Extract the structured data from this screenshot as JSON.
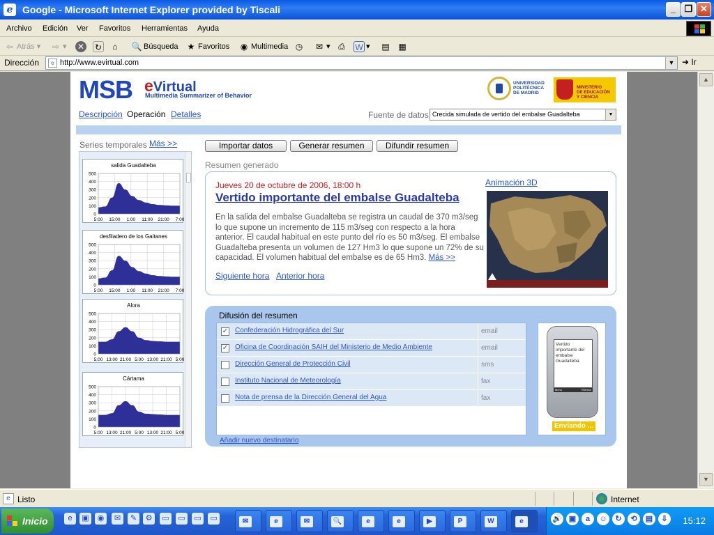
{
  "window": {
    "title": "Google - Microsoft Internet Explorer provided by Tiscali"
  },
  "menu": [
    "Archivo",
    "Edición",
    "Ver",
    "Favoritos",
    "Herramientas",
    "Ayuda"
  ],
  "toolbar": {
    "back": "Atrás",
    "search": "Búsqueda",
    "favorites": "Favoritos",
    "multimedia": "Multimedia"
  },
  "address": {
    "label": "Dirección",
    "url": "http://www.evirtual.com",
    "go": "Ir"
  },
  "page": {
    "logo": {
      "msb": "MSB",
      "ev_e": "e",
      "ev_rest": "Virtual",
      "subtitle": "Multimedia Summarizer of Behavior"
    },
    "upm_text": "UNIVERSIDAD\nPOLITÉCNICA\nDE MADRID",
    "mec_text": "MINISTERIO\nDE EDUCACIÓN\nY CIENCIA",
    "nav": {
      "descripcion": "Descripción",
      "operacion": "Operación",
      "detalles": "Detalles"
    },
    "fuente": {
      "label": "Fuente de datos:",
      "value": "Crecida simulada de vertido del embalse Guadalteba"
    },
    "series": {
      "title": "Series temporales",
      "more": "Más >>"
    },
    "buttons": {
      "importar": "Importar datos",
      "generar": "Generar resumen",
      "difundir": "Difundir resumen"
    },
    "resumen_label": "Resumen generado",
    "summary": {
      "date": "Jueves 20 de octubre de 2006, 18:00 h",
      "headline": "Vertido importante del embalse Guadalteba",
      "body": "En la salida del embalse Guadalteba se registra un caudal de 370 m3/seg lo que supone un incremento de 115 m3/seg con respecto a la hora anterior. El caudal habitual en este punto del río es 50 m3/seg. El embalse Guadalteba presenta un volumen de 127 Hm3 lo que supone un 72% de su capacidad. El volumen habitual del embalse es de 65 Hm3.",
      "more": "Más >>",
      "anim": "Animación 3D",
      "next": "Siguiente hora",
      "prev": "Anterior hora"
    },
    "difusion": {
      "title": "Difusión del resumen",
      "rows": [
        {
          "name": "Confederación Hidrográfica del Sur",
          "type": "email",
          "checked": true
        },
        {
          "name": "Oficina de Coordinación SAIH del Ministerio de Medio Ambiente",
          "type": "email",
          "checked": true
        },
        {
          "name": "Dirección General de Protección Civil",
          "type": "sms",
          "checked": false
        },
        {
          "name": "Instituto Nacional de Meteorología",
          "type": "fax",
          "checked": false
        },
        {
          "name": "Nota de prensa de la Dirección General del Agua",
          "type": "fax",
          "checked": false
        }
      ],
      "phone_text": "Vertido importante del embalse Guadalteba",
      "phone_keys_left": "Menu",
      "phone_keys_right": "Refresh",
      "sending": "Enviando ...",
      "add": "Añadir nuevo destinatario"
    }
  },
  "chart_data": [
    {
      "type": "area",
      "title": "salida Guadalteba",
      "ylim": [
        0,
        500
      ],
      "yticks": [
        0,
        100,
        200,
        300,
        400,
        500
      ],
      "xticks": [
        "5:00",
        "15:00",
        "1:00",
        "11:00",
        "21:00",
        "7:00"
      ],
      "values": [
        80,
        90,
        200,
        380,
        300,
        220,
        170,
        140,
        120,
        110,
        105,
        100,
        100
      ]
    },
    {
      "type": "area",
      "title": "desfiladero de los Gaitanes",
      "ylim": [
        0,
        500
      ],
      "yticks": [
        0,
        100,
        200,
        300,
        400,
        500
      ],
      "xticks": [
        "5:00",
        "15:00",
        "1:00",
        "11:00",
        "21:00",
        "7:00"
      ],
      "values": [
        80,
        90,
        180,
        360,
        300,
        220,
        170,
        140,
        120,
        110,
        105,
        100,
        100
      ]
    },
    {
      "type": "area",
      "title": "Alora",
      "ylim": [
        0,
        500
      ],
      "yticks": [
        0,
        100,
        200,
        300,
        400,
        500
      ],
      "xticks": [
        "5:00",
        "13:00",
        "21:00",
        "5:00",
        "13:00",
        "21:00",
        "5:00"
      ],
      "values": [
        150,
        150,
        180,
        280,
        330,
        280,
        200,
        170,
        160,
        155,
        150,
        150,
        150
      ]
    },
    {
      "type": "area",
      "title": "Cártama",
      "ylim": [
        0,
        500
      ],
      "yticks": [
        0,
        100,
        200,
        300,
        400,
        500
      ],
      "xticks": [
        "5:00",
        "13:00",
        "21:00",
        "5:00",
        "13:00",
        "21:00",
        "5:00"
      ],
      "values": [
        150,
        150,
        170,
        270,
        320,
        270,
        190,
        165,
        160,
        155,
        150,
        150,
        150
      ]
    }
  ],
  "status": {
    "text": "Listo",
    "zone": "Internet"
  },
  "taskbar": {
    "start": "Inicio",
    "clock": "15:12"
  }
}
